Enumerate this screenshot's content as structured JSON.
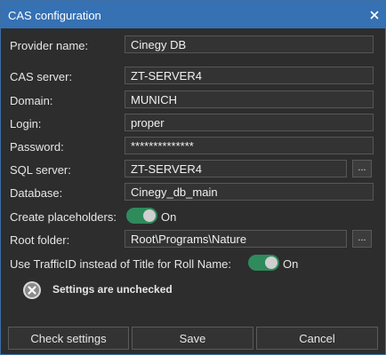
{
  "window": {
    "title": "CAS configuration",
    "close_icon": "close-icon",
    "title_bar_color": "#3571b3"
  },
  "form": {
    "provider_name": {
      "label": "Provider name:",
      "value": "Cinegy DB"
    },
    "cas_server": {
      "label": "CAS server:",
      "value": "ZT-SERVER4"
    },
    "domain": {
      "label": "Domain:",
      "value": "MUNICH"
    },
    "login": {
      "label": "Login:",
      "value": "proper"
    },
    "password": {
      "label": "Password:",
      "value": "**************"
    },
    "sql_server": {
      "label": "SQL server:",
      "value": "ZT-SERVER4",
      "browse_label": "..."
    },
    "database": {
      "label": "Database:",
      "value": "Cinegy_db_main"
    },
    "create_placeholders": {
      "label": "Create placeholders:",
      "state": "On"
    },
    "root_folder": {
      "label": "Root folder:",
      "value": "Root\\Programs\\Nature",
      "browse_label": "..."
    },
    "use_trafficid": {
      "label": "Use TrafficID instead of Title for Roll Name:",
      "state": "On"
    }
  },
  "status": {
    "icon": "error-circle-icon",
    "text": "Settings are unchecked"
  },
  "footer": {
    "check_settings_label": "Check settings",
    "save_label": "Save",
    "cancel_label": "Cancel"
  },
  "colors": {
    "toggle_on": "#2f8a5c",
    "background": "#2d2d2d",
    "accent": "#3571b3"
  }
}
